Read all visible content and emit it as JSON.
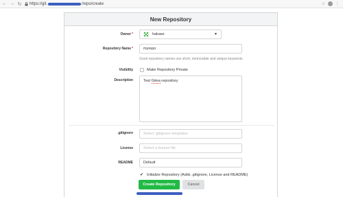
{
  "browser": {
    "url_prefix": "https://git.",
    "url_suffix": "/repo/create"
  },
  "form": {
    "title": "New Repository",
    "owner": {
      "label": "Owner",
      "value": "hakase"
    },
    "repo_name": {
      "label": "Repository Name",
      "value": "myrepo",
      "help": "Good repository names use short, memorable and unique keywords."
    },
    "visibility": {
      "label": "Visibility",
      "checkbox_label": "Make Repository Private",
      "checked": false
    },
    "description": {
      "label": "Description",
      "text_pre": "Test ",
      "text_misspelled": "Gitea",
      "text_post": " repository"
    },
    "gitignore": {
      "label": ".gitignore",
      "placeholder": "Select .gitignore templates"
    },
    "license": {
      "label": "License",
      "placeholder": "Select a license file"
    },
    "readme": {
      "label": "README",
      "value": "Default"
    },
    "init": {
      "label": "Initialize Repository (Adds .gitignore, License and README)",
      "checked": true
    },
    "create_button": "Create Repository",
    "cancel_button": "Cancel"
  },
  "colors": {
    "primary": "#21ba45",
    "redaction": "#3b5fc0"
  }
}
